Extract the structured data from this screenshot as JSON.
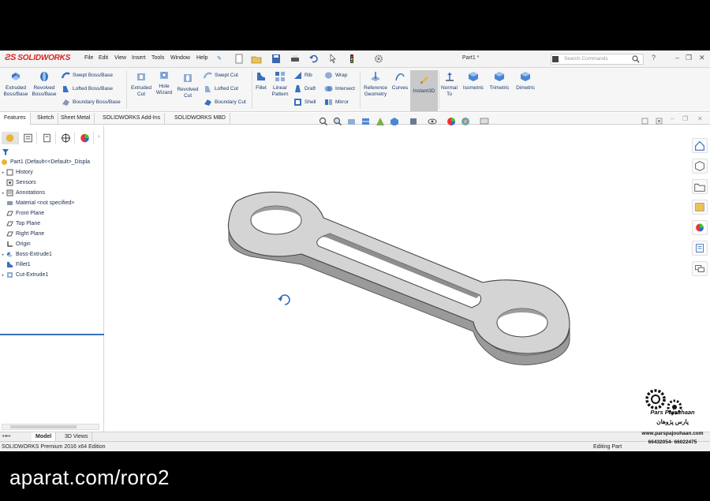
{
  "app": {
    "logo_text": "SOLIDWORKS",
    "menu": [
      "File",
      "Edit",
      "View",
      "Insert",
      "Tools",
      "Window",
      "Help"
    ],
    "document_title": "Part1 *",
    "search_placeholder": "Search Commands"
  },
  "ribbon": {
    "extruded_boss": "Extruded Boss/Base",
    "revolved_boss": "Revolved Boss/Base",
    "swept_boss": "Swept Boss/Base",
    "lofted_boss": "Lofted Boss/Base",
    "boundary_boss": "Boundary Boss/Base",
    "extruded_cut": "Extruded Cut",
    "hole_wizard": "Hole Wizard",
    "revolved_cut": "Revolved Cut",
    "swept_cut": "Swept Cut",
    "lofted_cut": "Lofted Cut",
    "boundary_cut": "Boundary Cut",
    "fillet": "Fillet",
    "linear_pattern": "Linear Pattern",
    "rib": "Rib",
    "draft": "Draft",
    "shell": "Shell",
    "wrap": "Wrap",
    "intersect": "Intersect",
    "mirror": "Mirror",
    "reference_geometry": "Reference Geometry",
    "curves": "Curves",
    "instant3d": "Instant3D",
    "normal_to": "Normal To",
    "isometric": "Isometric",
    "trimetric": "Trimetric",
    "dimetric": "Dimetric"
  },
  "tabs": [
    "Features",
    "Sketch",
    "Sheet Metal",
    "SOLIDWORKS Add-Ins",
    "SOLIDWORKS MBD"
  ],
  "tree": {
    "root": "Part1  (Default<<Default>_Displa",
    "items": [
      "History",
      "Sensors",
      "Annotations",
      "Material <not specified>",
      "Front Plane",
      "Top Plane",
      "Right Plane",
      "Origin",
      "Boss-Extrude1",
      "Fillet1",
      "Cut-Extrude1"
    ]
  },
  "bottom_tabs": [
    "Model",
    "3D Views"
  ],
  "status": {
    "left": "SOLIDWORKS Premium 2016 x64 Edition",
    "right": "Editing Part"
  },
  "watermark": {
    "name": "Pars Pajouhaan",
    "name_fa": "پارس پژوهان",
    "site": "www.parspajouhaan.com",
    "phone": "66432054- 66022475"
  },
  "brand": "aparat.com/roro2",
  "colors": {
    "accent": "#3a70c0",
    "logo_red": "#d22222",
    "part_gray": "#c8c8c8"
  }
}
